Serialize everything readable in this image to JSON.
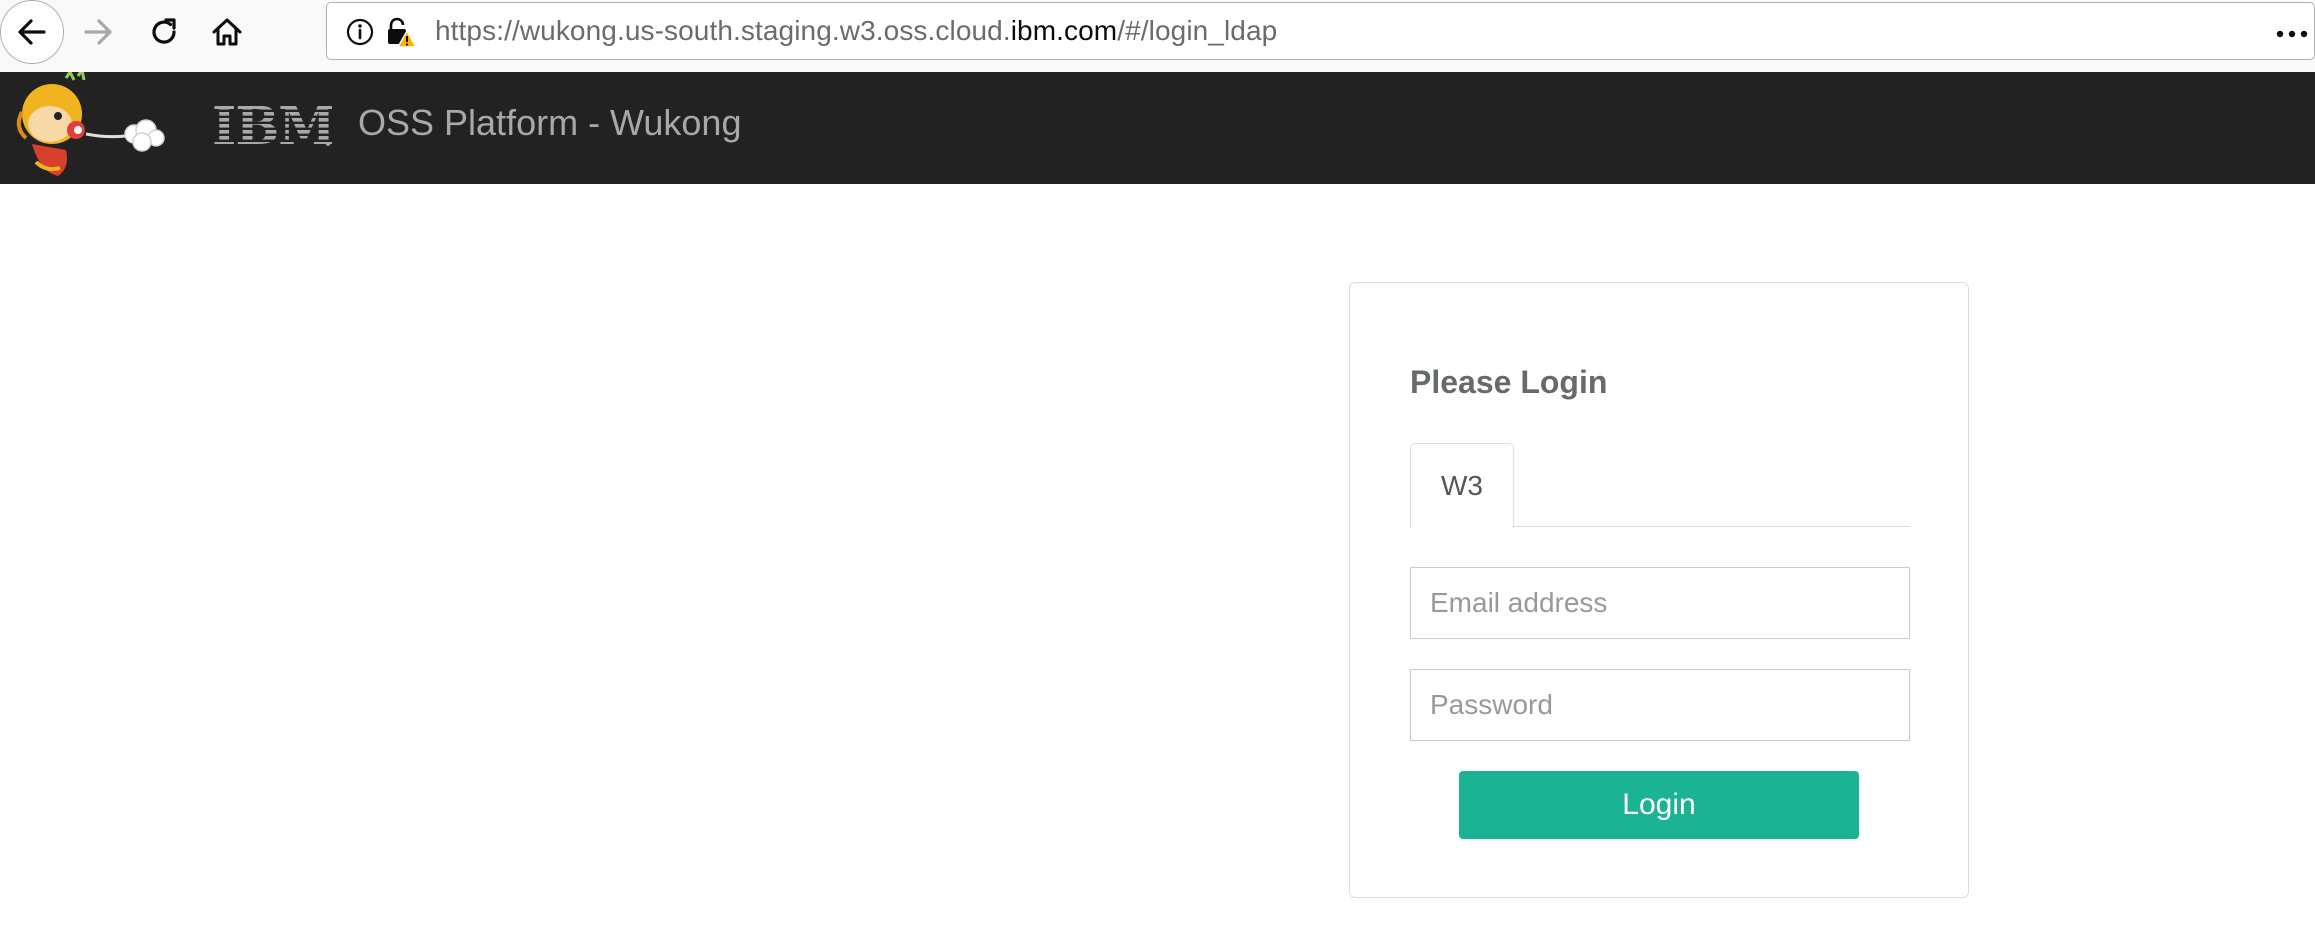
{
  "browser": {
    "url_prefix": "https://wukong.us-south.staging.w3.oss.cloud.",
    "url_host": "ibm.com",
    "url_suffix": "/#/login_ldap",
    "icons": [
      "back-icon",
      "forward-icon",
      "reload-icon",
      "home-icon",
      "info-icon",
      "insecure-lock-icon",
      "more-icon"
    ]
  },
  "header": {
    "logo_text": "IBM",
    "title": "OSS Platform - Wukong"
  },
  "login": {
    "title": "Please Login",
    "tabs": [
      {
        "label": "W3",
        "active": true
      }
    ],
    "email": {
      "placeholder": "Email address",
      "value": ""
    },
    "password": {
      "placeholder": "Password",
      "value": ""
    },
    "submit_label": "Login"
  },
  "colors": {
    "header_bg": "#222222",
    "accent": "#1ab394",
    "title_text": "#676a6c"
  }
}
